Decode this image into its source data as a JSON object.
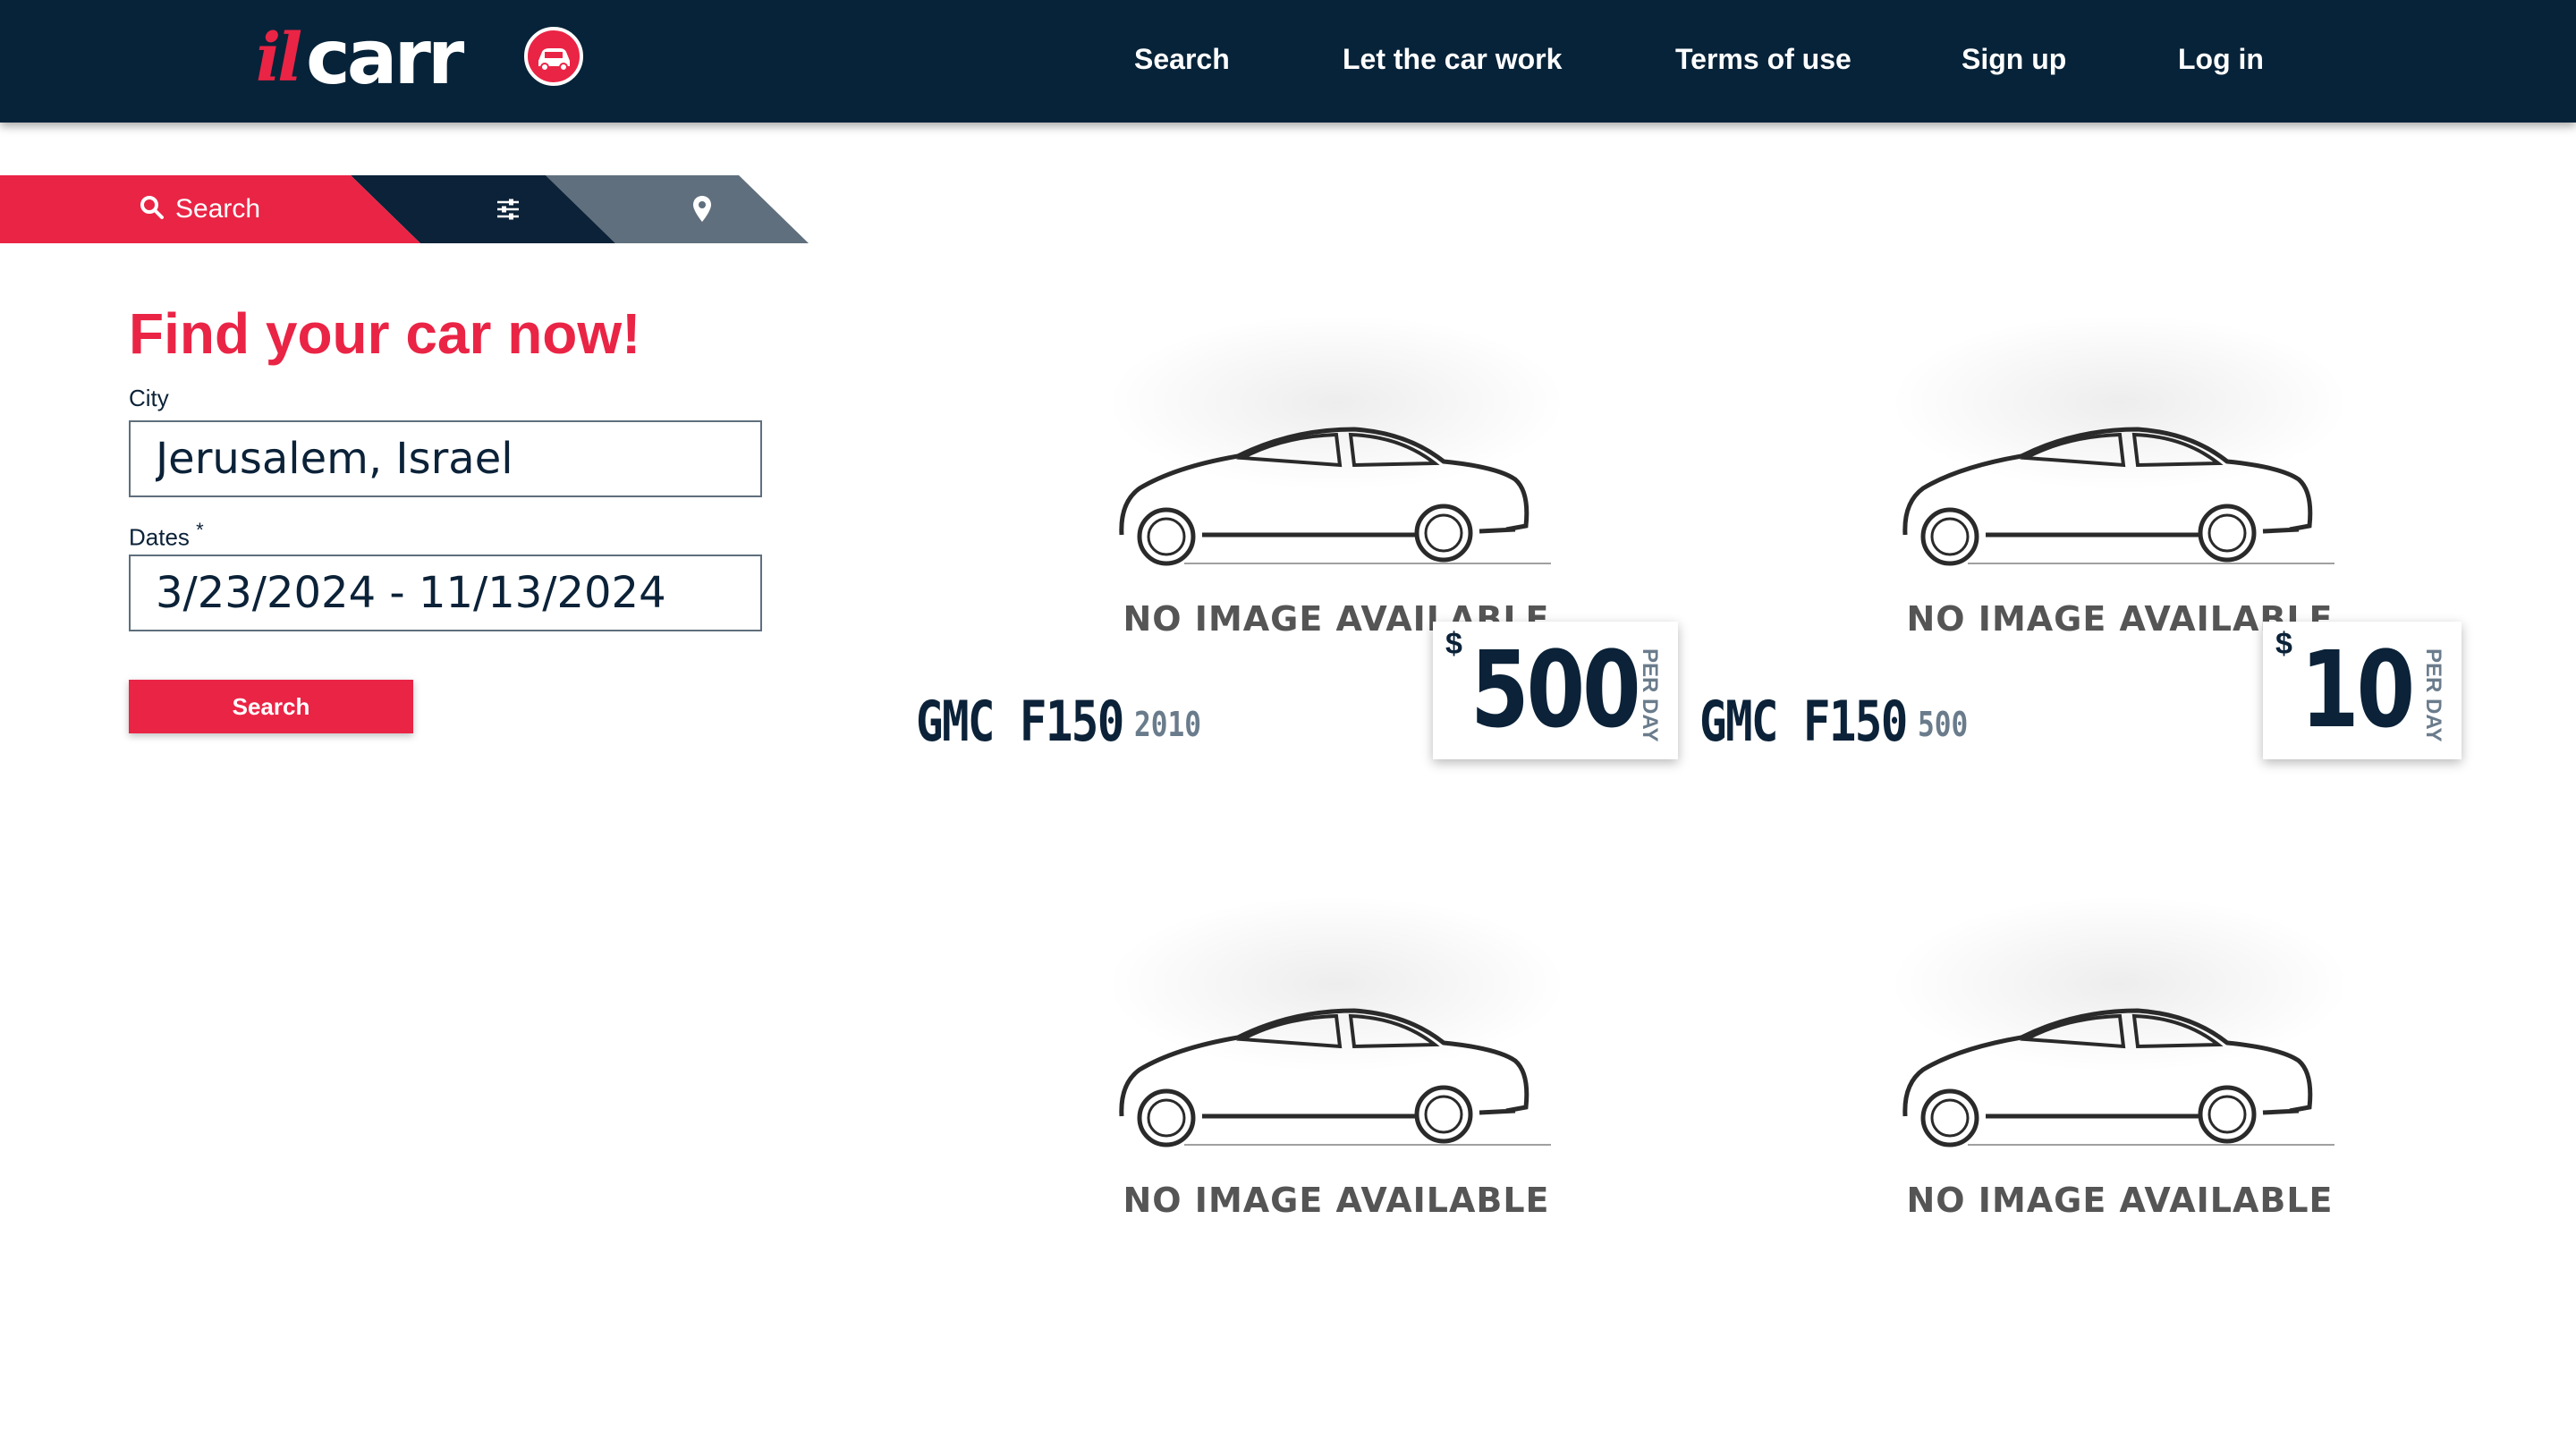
{
  "header": {
    "logo_prefix": "il",
    "logo_main": "carr",
    "nav": [
      {
        "label": "Search"
      },
      {
        "label": "Let the car work"
      },
      {
        "label": "Terms of use"
      },
      {
        "label": "Sign up"
      },
      {
        "label": "Log in"
      }
    ]
  },
  "tabs": {
    "search_label": "Search",
    "search_icon": "search-icon",
    "filter_icon": "sliders-icon",
    "location_icon": "map-pin-icon"
  },
  "form": {
    "title": "Find your car now!",
    "city_label": "City",
    "city_value": "Jerusalem, Israel",
    "dates_label": "Dates",
    "dates_required_mark": "*",
    "dates_value": "3/23/2024 - 11/13/2024",
    "search_button": "Search"
  },
  "cars": [
    {
      "placeholder": "NO IMAGE AVAILABLE",
      "name": "GMC F150",
      "year": "2010",
      "currency": "$",
      "price": "500",
      "per": "PER DAY"
    },
    {
      "placeholder": "NO IMAGE AVAILABLE",
      "name": "GMC F150",
      "year": "500",
      "currency": "$",
      "price": "10",
      "per": "PER DAY"
    },
    {
      "placeholder": "NO IMAGE AVAILABLE"
    },
    {
      "placeholder": "NO IMAGE AVAILABLE"
    }
  ],
  "colors": {
    "header_bg": "#072339",
    "accent": "#ea2445",
    "navy": "#0b2238",
    "slate": "#5f6f7d"
  }
}
